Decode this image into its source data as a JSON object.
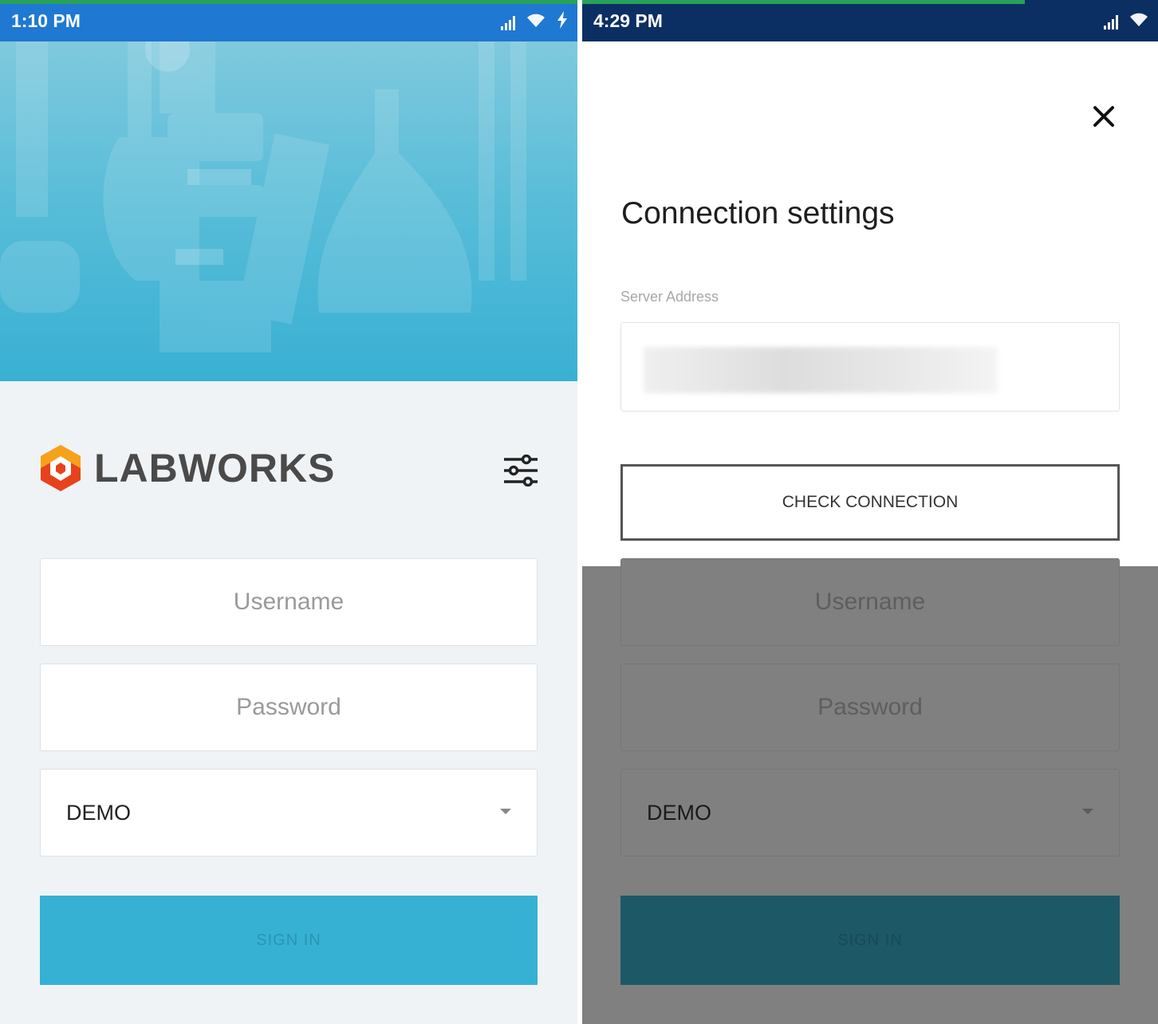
{
  "left_screen": {
    "status_bar": {
      "time": "1:10 PM",
      "color": "#1f78d1",
      "icons": [
        "signal-icon",
        "wifi-icon",
        "charging-icon"
      ]
    },
    "logo": {
      "text": "LABWORKS",
      "colors": [
        "#f6a11a",
        "#e8421d"
      ]
    },
    "username_placeholder": "Username",
    "password_placeholder": "Password",
    "database_select": {
      "value": "DEMO"
    },
    "sign_in_label": "SIGN IN",
    "settings_icon": "sliders-icon"
  },
  "right_screen": {
    "status_bar": {
      "time": "4:29 PM",
      "color": "#0b2f63",
      "icons": [
        "signal-icon",
        "wifi-icon"
      ]
    },
    "dialog": {
      "title": "Connection settings",
      "server_address_label": "Server Address",
      "server_address_value": "",
      "check_connection_label": "CHECK CONNECTION",
      "close_icon": "close-icon"
    },
    "background_form": {
      "username_placeholder": "Username",
      "password_placeholder": "Password",
      "database_value": "DEMO",
      "sign_in_label": "SIGN IN"
    }
  }
}
